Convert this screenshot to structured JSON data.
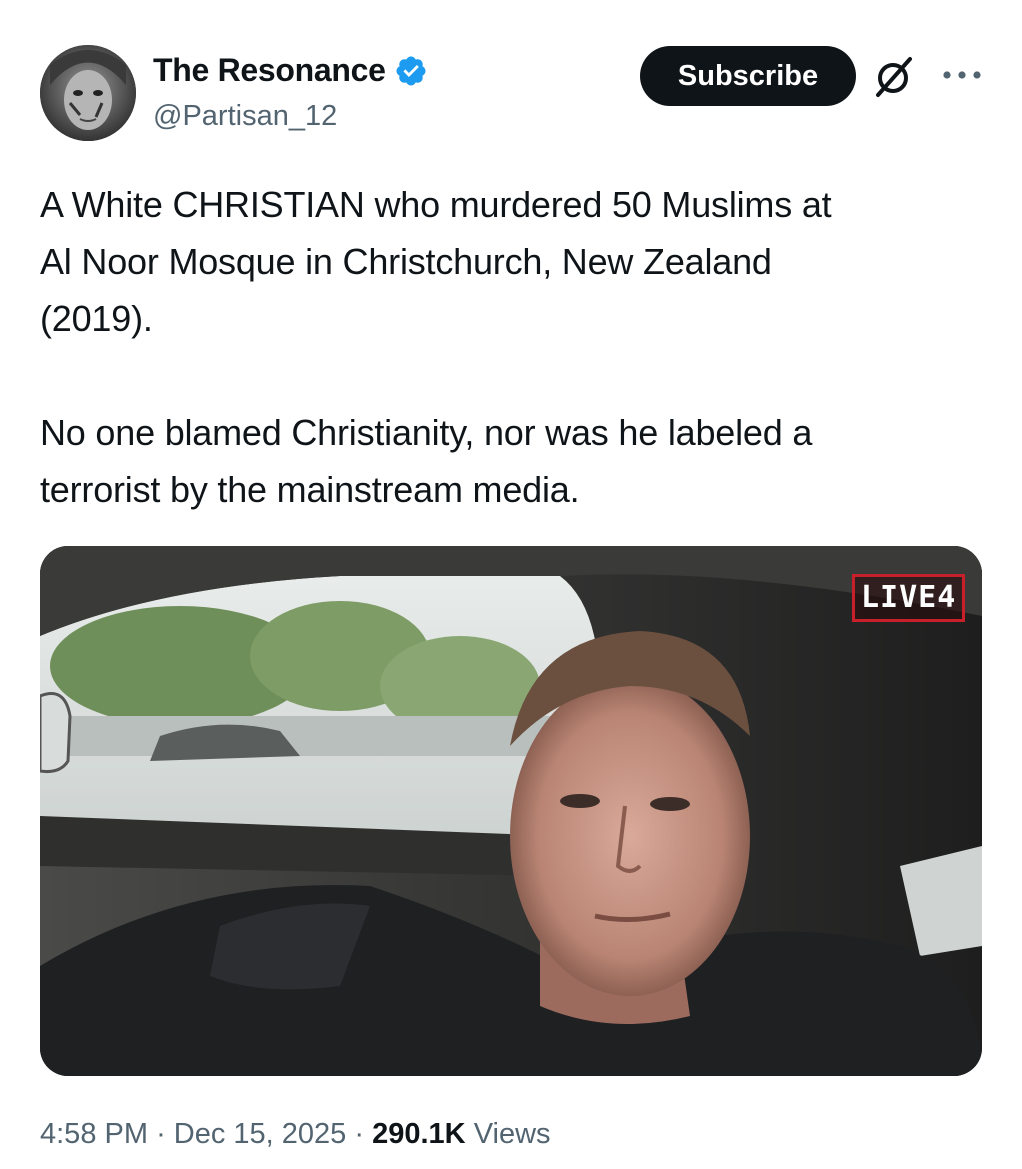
{
  "author": {
    "display_name": "The Resonance",
    "handle": "@Partisan_12",
    "verified": true,
    "verified_color": "#1d9bf0"
  },
  "actions": {
    "subscribe_label": "Subscribe"
  },
  "tweet": {
    "paragraphs": [
      "A White CHRISTIAN who murdered 50 Muslims at\nAl Noor Mosque in Christchurch, New Zealand\n(2019).",
      "No one blamed Christianity, nor was he labeled a\nterrorist by the mainstream media."
    ]
  },
  "media": {
    "overlay_badge": "LIVE4"
  },
  "meta": {
    "time": "4:58 PM",
    "separator": "·",
    "date": "Dec 15, 2025",
    "views_count": "290.1K",
    "views_label": "Views"
  },
  "colors": {
    "text_primary": "#0f1419",
    "text_secondary": "#536471",
    "button_bg": "#0f1419",
    "badge_border": "#c8202a"
  }
}
